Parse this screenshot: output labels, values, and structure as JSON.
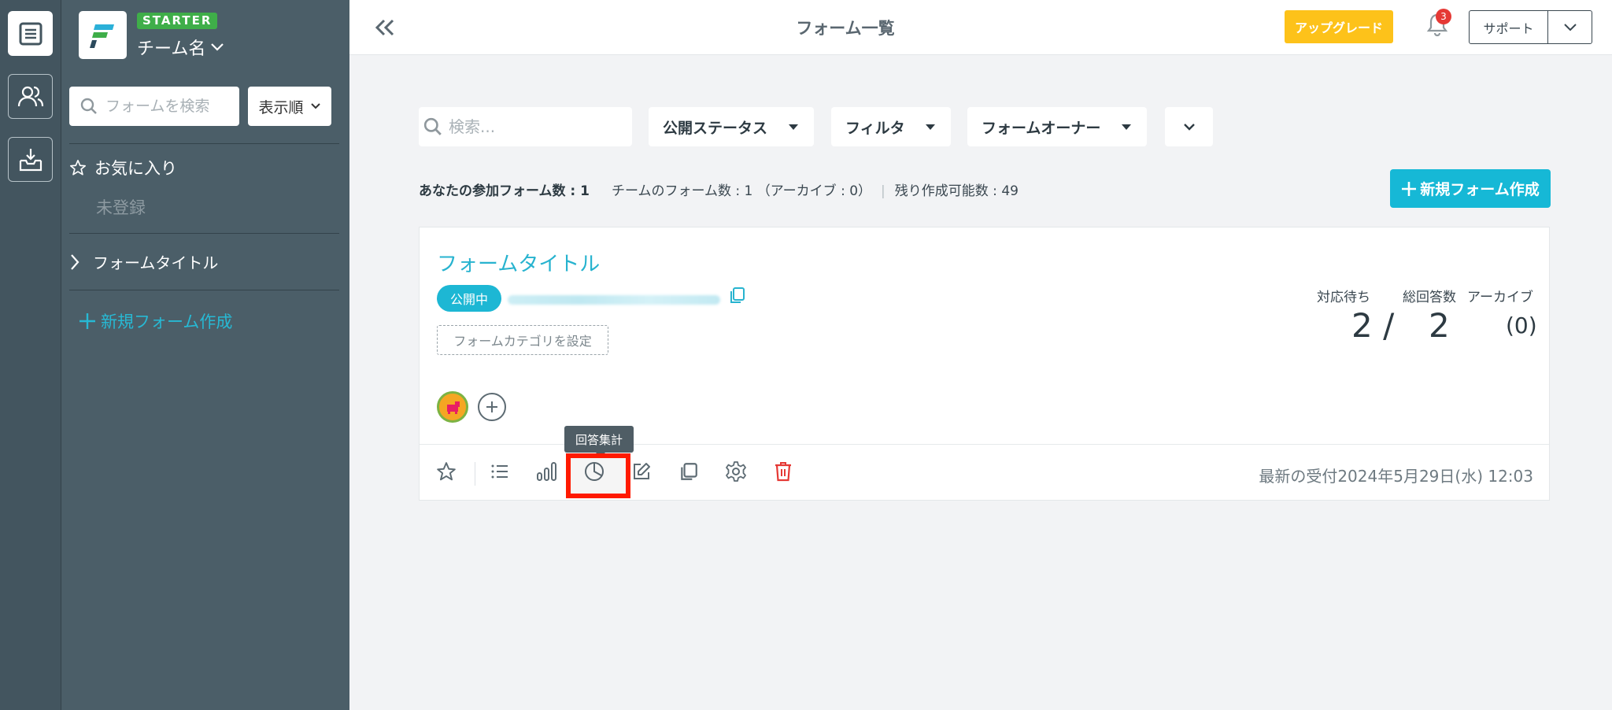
{
  "rail": {
    "items": [
      {
        "name": "forms-icon",
        "active": true
      },
      {
        "name": "users-icon",
        "active": false
      },
      {
        "name": "inbox-download-icon",
        "active": false
      }
    ]
  },
  "sidebar": {
    "plan_badge": "STARTER",
    "team_name": "チーム名",
    "search_placeholder": "フォームを検索",
    "sort_label": "表示順",
    "favorites_label": "お気に入り",
    "favorites_empty": "未登録",
    "form_item": "フォームタイトル",
    "new_form": "新規フォーム作成"
  },
  "header": {
    "title": "フォーム一覧",
    "upgrade": "アップグレード",
    "notification_count": "3",
    "support": "サポート"
  },
  "filters": {
    "search_placeholder": "検索...",
    "status": "公開ステータス",
    "filter": "フィルタ",
    "owner": "フォームオーナー"
  },
  "counts": {
    "joined": "あなたの参加フォーム数 : 1",
    "team": "チームのフォーム数 : 1 （アーカイブ : 0）",
    "remaining": "残り作成可能数 : 49",
    "new_form_button": "新規フォーム作成"
  },
  "card": {
    "title": "フォームタイトル",
    "status": "公開中",
    "category_button": "フォームカテゴリを設定",
    "stats": {
      "pending_label": "対応待ち",
      "total_label": "総回答数",
      "archive_label": "アーカイブ",
      "pending": "2 /",
      "total": "2",
      "archive": "(0)"
    },
    "latest_received": "最新の受付2024年5月29日(水) 12:03",
    "tooltip": "回答集計"
  },
  "colors": {
    "accent": "#16b8d6",
    "upgrade": "#fdc21a",
    "sidebar": "#4b5e68",
    "rail": "#43555f",
    "highlight": "#ff1a00",
    "delete": "#e53935"
  }
}
